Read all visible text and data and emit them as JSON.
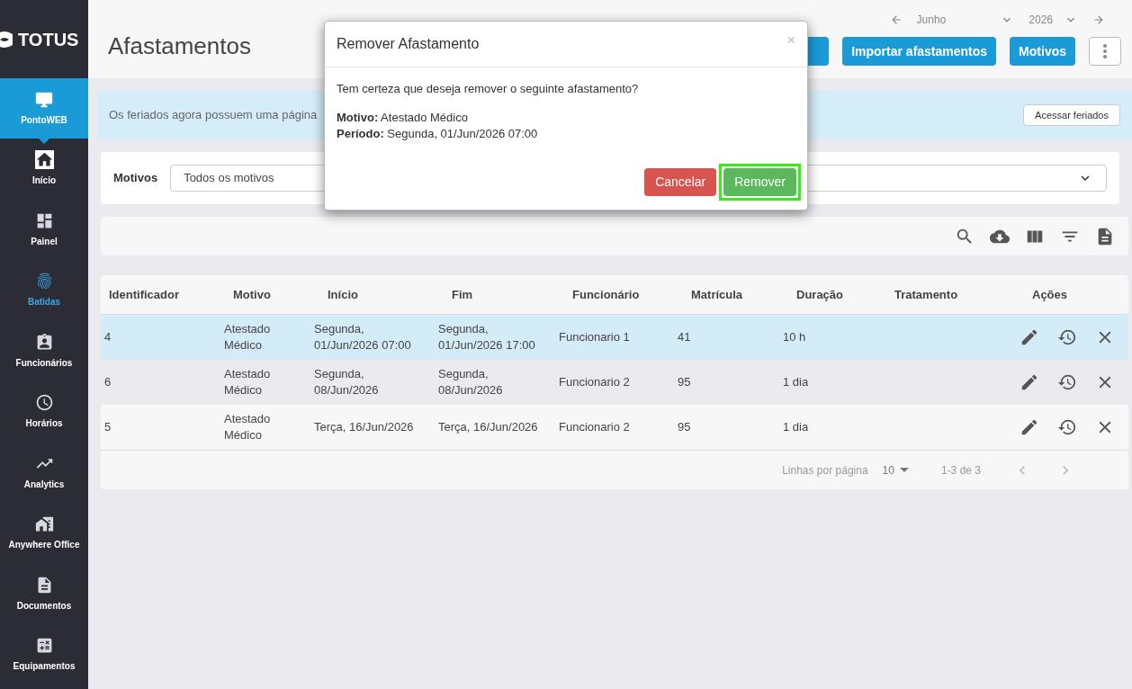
{
  "sidebar": {
    "logo": "TOTUS",
    "app": {
      "label": "PontoWEB",
      "selected": true
    },
    "items": [
      {
        "label": "Início",
        "selected": false
      },
      {
        "label": "Painel",
        "selected": false
      },
      {
        "label": "Batidas",
        "selected": true
      },
      {
        "label": "Funcionários",
        "selected": false
      },
      {
        "label": "Horários",
        "selected": false
      },
      {
        "label": "Analytics",
        "selected": false
      },
      {
        "label": "Anywhere Office",
        "selected": false
      },
      {
        "label": "Documentos",
        "selected": false
      },
      {
        "label": "Equipamentos",
        "selected": false
      }
    ]
  },
  "header": {
    "title": "Afastamentos",
    "month": "Junho",
    "year": "2026",
    "buttons": [
      "Importar afastamentos",
      "Motivos"
    ]
  },
  "banner": {
    "text": "Os feriados agora possuem uma página",
    "button": "Acessar feriados"
  },
  "filter": {
    "label": "Motivos",
    "value": "Todos os motivos"
  },
  "table": {
    "columns": [
      "Identificador",
      "Motivo",
      "Início",
      "Fim",
      "Funcionário",
      "Matrícula",
      "Duração",
      "Tratamento",
      "Ações"
    ],
    "rows": [
      {
        "selected": true,
        "cells": [
          "4",
          "Atestado Médico",
          "Segunda, 01/Jun/2026 07:00",
          "Segunda, 01/Jun/2026 17:00",
          "Funcionario 1",
          "41",
          "10 h",
          ""
        ]
      },
      {
        "selected": false,
        "cells": [
          "6",
          "Atestado Médico",
          "Segunda, 08/Jun/2026",
          "Segunda, 08/Jun/2026",
          "Funcionario 2",
          "95",
          "1 dia",
          ""
        ]
      },
      {
        "selected": false,
        "cells": [
          "5",
          "Atestado Médico",
          "Terça, 16/Jun/2026",
          "Terça, 16/Jun/2026",
          "Funcionario 2",
          "95",
          "1 dia",
          ""
        ]
      }
    ],
    "footer": {
      "rows_label": "Linhas por página",
      "rows_value": "10",
      "range": "1-3 de 3"
    }
  },
  "dialog": {
    "title": "Remover Afastamento",
    "close": "×",
    "question": "Tem certeza que deseja remover o seguinte afastamento?",
    "details": [
      "**Motivo:** Atestado Médico",
      "**Período:** Segunda, 01/Jun/2026 07:00"
    ],
    "cancel": "Cancelar",
    "confirm": {
      "label": "Remover",
      "focused": true
    }
  }
}
